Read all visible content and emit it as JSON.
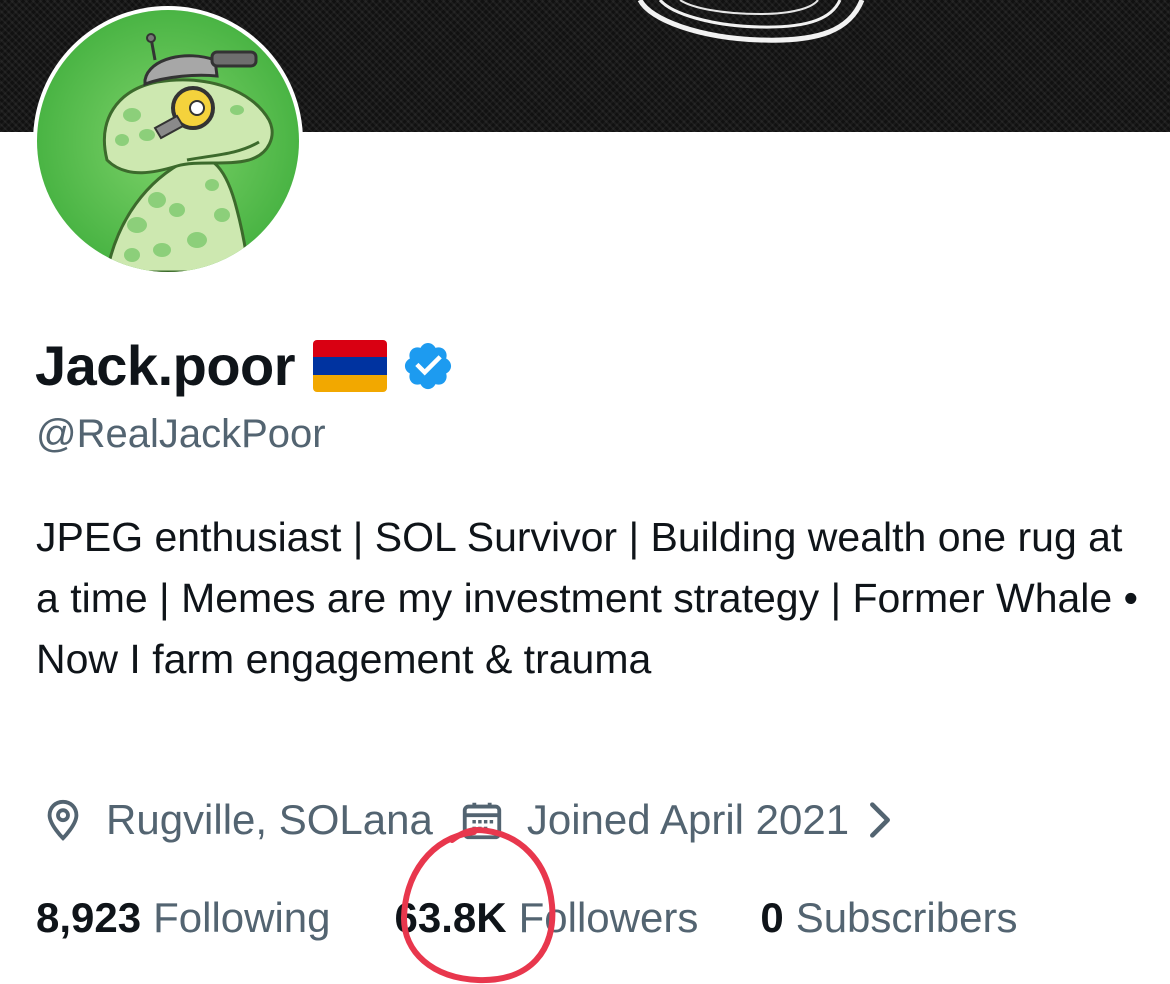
{
  "profile": {
    "display_name": "Jack.poor",
    "handle": "@RealJackPoor",
    "bio": "JPEG enthusiast | SOL Survivor | Building wealth one rug at a time | Memes are my investment strategy | Former Whale • Now I farm engagement & trauma",
    "location": "Rugville, SOLana",
    "joined": "Joined April 2021",
    "flag_colors": [
      "#d90012",
      "#0033a0",
      "#f2a800"
    ],
    "verified_color": "#1d9bf0"
  },
  "stats": {
    "following_count": "8,923",
    "following_label": "Following",
    "followers_count": "63.8K",
    "followers_label": "Followers",
    "subscribers_count": "0",
    "subscribers_label": "Subscribers"
  },
  "annotation": {
    "highlight_color": "#e8374d"
  },
  "icons": {
    "location": "location-pin-icon",
    "calendar": "calendar-icon",
    "chevron": "chevron-right-icon",
    "verified": "verified-badge-icon",
    "flag": "armenia-flag-icon"
  }
}
